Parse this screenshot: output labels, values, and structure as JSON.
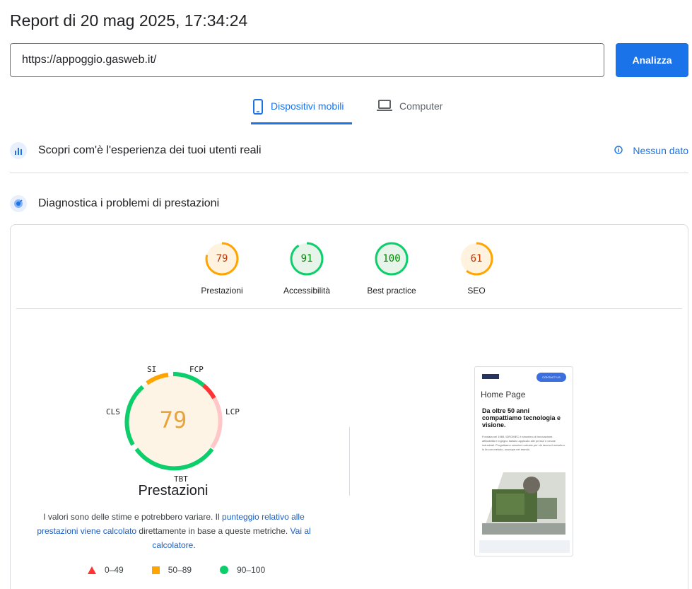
{
  "report": {
    "title": "Report di 20 mag 2025, 17:34:24"
  },
  "search": {
    "url_value": "https://appoggio.gasweb.it/",
    "analyze_label": "Analizza"
  },
  "tabs": [
    {
      "label": "Dispositivi mobili",
      "icon": "smartphone-icon",
      "active": true
    },
    {
      "label": "Computer",
      "icon": "laptop-icon",
      "active": false
    }
  ],
  "real_users": {
    "label": "Scopri com'è l'esperienza dei tuoi utenti reali",
    "status": "Nessun dato"
  },
  "diagnostics": {
    "label": "Diagnostica i problemi di prestazioni"
  },
  "scores": [
    {
      "value": "79",
      "label": "Prestazioni",
      "color": "#ffa400",
      "text_color": "#c33300",
      "bg": "#fff3e0",
      "fraction": 0.79
    },
    {
      "value": "91",
      "label": "Accessibilità",
      "color": "#0cce6b",
      "text_color": "#008800",
      "bg": "#e6f4ea",
      "fraction": 0.91
    },
    {
      "value": "100",
      "label": "Best practice",
      "color": "#0cce6b",
      "text_color": "#008800",
      "bg": "#e6f4ea",
      "fraction": 1.0
    },
    {
      "value": "61",
      "label": "SEO",
      "color": "#ffa400",
      "text_color": "#c33300",
      "bg": "#fff3e0",
      "fraction": 0.61
    }
  ],
  "performance": {
    "score": "79",
    "title": "Prestazioni",
    "metrics": [
      "SI",
      "FCP",
      "LCP",
      "TBT",
      "CLS"
    ],
    "note": {
      "text1": "I valori sono delle stime e potrebbero variare. Il ",
      "link1": "punteggio relativo alle prestazioni viene calcolato",
      "text2": " direttamente in base a queste metriche. ",
      "link2": "Vai al calcolatore",
      "text3": "."
    }
  },
  "legend": [
    {
      "label": "0–49",
      "shape": "triangle",
      "color": "#ff3333"
    },
    {
      "label": "50–89",
      "shape": "square",
      "color": "#ffa400"
    },
    {
      "label": "90–100",
      "shape": "circle",
      "color": "#0cce6b"
    }
  ],
  "screenshot": {
    "contact": "CONTACT US",
    "home": "Home Page",
    "headline": "Da oltre 50 anni compattiamo tecnologia e visione.",
    "body": "Fondata nel 1965, IDROMEC è sinonimo di innovazione, affidabilità e ingegno italiano applicato alle presse e cesoie industriali. Progettiamo soluzioni robuste per chi lavora il metallo e lo fa con metodo, ovunque nel mondo."
  },
  "colors": {
    "accent": "#1a73e8",
    "pass": "#0cce6b",
    "average": "#ffa400",
    "fail": "#ff3333"
  }
}
